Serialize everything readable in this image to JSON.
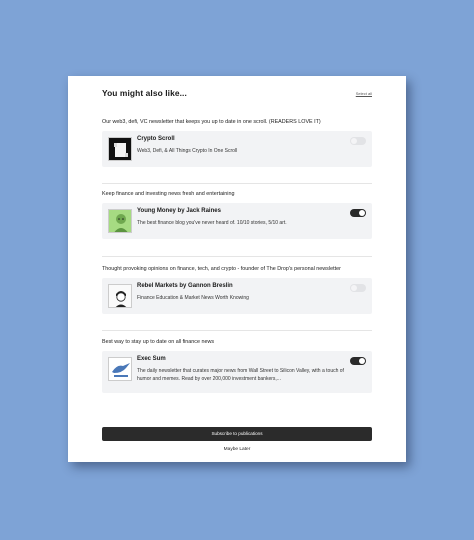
{
  "header": {
    "title": "You might also like...",
    "select_all": "Select all"
  },
  "sections": [
    {
      "description": "Our web3, defi, VC newsletter that keeps you up to date in one scroll. (READERS LOVE IT)",
      "name": "Crypto Scroll",
      "tagline": "Web3, Defi, & All Things Crypto In One Scroll",
      "subscribed": false,
      "logo_icon": "scroll-logo"
    },
    {
      "description": "Keep finance and investing news fresh and entertaining",
      "name": "Young Money by Jack Raines",
      "tagline": "The best finance blog you've never heard of. 10/10 stories, 5/10 art.",
      "subscribed": true,
      "logo_icon": "portrait-logo"
    },
    {
      "description": "Thought provoking opinions on finance, tech, and crypto - founder of The Drop's personal newsletter",
      "name": "Rebel Markets by Gannon Breslin",
      "tagline": "Finance Education & Market News Worth Knowing",
      "subscribed": false,
      "logo_icon": "avatar-logo"
    },
    {
      "description": "Best way to stay up to date on all finance news",
      "name": "Exec Sum",
      "tagline": "The daily newsletter that curates major news from Wall Street to Silicon Valley, with a touch of humor and memes. Read by over 200,000 investment bankers,...",
      "subscribed": true,
      "logo_icon": "exec-sum-logo"
    }
  ],
  "footer": {
    "subscribe_label": "Subscribe to publications",
    "maybe_later": "Maybe Later"
  },
  "colors": {
    "background": "#7ea3d6",
    "toggle_on": "#2a2a2a",
    "toggle_off": "#e2e3e6",
    "button": "#2b2b2b"
  }
}
